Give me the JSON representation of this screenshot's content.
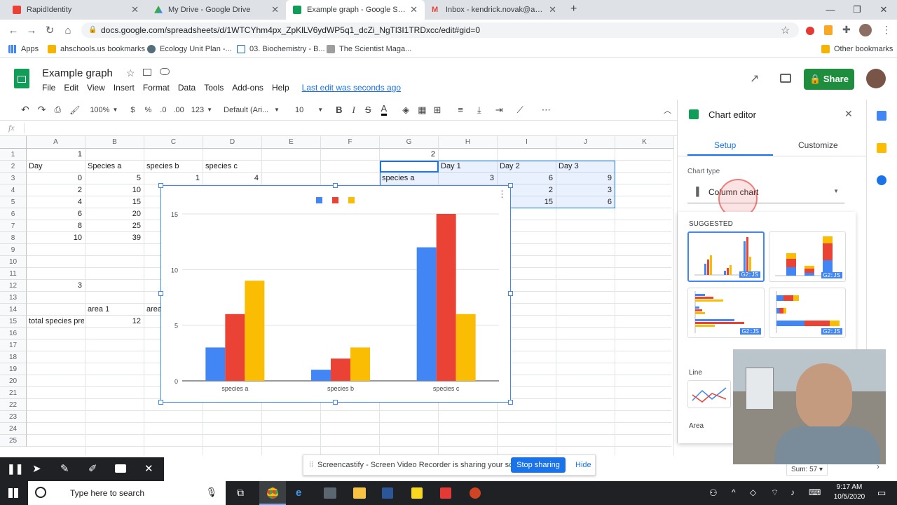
{
  "browser": {
    "tabs": [
      {
        "title": "RapidIdentity",
        "color": "#e94235"
      },
      {
        "title": "My Drive - Google Drive",
        "color": "#34a853"
      },
      {
        "title": "Example graph - Google Sheets",
        "color": "#0f9d58"
      },
      {
        "title": "Inbox - kendrick.novak@ahschoo",
        "color": "#ea4335"
      }
    ],
    "url": "docs.google.com/spreadsheets/d/1WTCYhm4px_ZpKlLV6ydWP5q1_dcZi_NgTl3I1TRDxcc/edit#gid=0",
    "bookmarks": [
      "Apps",
      "ahschools.us bookmarks",
      "Ecology Unit Plan -...",
      "03. Biochemistry - B...",
      "The Scientist Maga...",
      "Other bookmarks"
    ]
  },
  "doc": {
    "title": "Example graph",
    "menus": [
      "File",
      "Edit",
      "View",
      "Insert",
      "Format",
      "Data",
      "Tools",
      "Add-ons",
      "Help"
    ],
    "last_edit": "Last edit was seconds ago",
    "share": "Share"
  },
  "toolbar": {
    "zoom": "100%",
    "currency": "$",
    "percent": "%",
    "dec1": ".0",
    "dec2": ".00",
    "numfmt": "123",
    "font": "Default (Ari...",
    "size": "10",
    "bold": "B",
    "italic": "I",
    "strike": "S",
    "color": "A"
  },
  "fx": "fx",
  "columns": [
    "A",
    "B",
    "C",
    "D",
    "E",
    "F",
    "G",
    "H",
    "I",
    "J",
    "K"
  ],
  "rows": [
    "1",
    "2",
    "3",
    "4",
    "5",
    "6",
    "7",
    "8",
    "9",
    "10",
    "11",
    "12",
    "13",
    "14",
    "15",
    "16",
    "17",
    "18",
    "19",
    "20",
    "21",
    "22",
    "23",
    "24",
    "25"
  ],
  "cells": {
    "a1": "1",
    "g1": "2",
    "a2": "Day",
    "b2": "Species a",
    "c2": "species b",
    "d2": "species c",
    "h2": "Day 1",
    "i2": "Day 2",
    "j2": "Day 3",
    "a3": "0",
    "b3": "5",
    "c3": "1",
    "d3": "4",
    "g3": "species a",
    "h3": "3",
    "i3": "6",
    "j3": "9",
    "a4": "2",
    "b4": "10",
    "i4": "2",
    "j4": "3",
    "a5": "4",
    "b5": "15",
    "i5": "15",
    "j5": "6",
    "a6": "6",
    "b6": "20",
    "a7": "8",
    "b7": "25",
    "a8": "10",
    "b8": "39",
    "a12": "3",
    "b14": "area 1",
    "c14": "area",
    "a15": "total species pre",
    "b15": "12"
  },
  "chart_data": {
    "type": "bar",
    "categories": [
      "species a",
      "species b",
      "species c"
    ],
    "series": [
      {
        "values": [
          3,
          1,
          12
        ],
        "color": "#4285f4"
      },
      {
        "values": [
          6,
          2,
          15
        ],
        "color": "#ea4335"
      },
      {
        "values": [
          9,
          3,
          6
        ],
        "color": "#fbbc04"
      }
    ],
    "ylim": [
      0,
      15
    ],
    "yticks": [
      "0",
      "5",
      "10",
      "15"
    ],
    "grid": true
  },
  "editor": {
    "title": "Chart editor",
    "tab_setup": "Setup",
    "tab_customize": "Customize",
    "chart_type_label": "Chart type",
    "chart_type_value": "Column chart",
    "suggested": "SUGGESTED",
    "badge": "G2::JS",
    "line": "Line",
    "area": "Area"
  },
  "screencast": {
    "message": "Screencastify - Screen Video Recorder is sharing your screen.",
    "stop": "Stop sharing",
    "hide": "Hide"
  },
  "status": {
    "sum": "Sum: 57"
  },
  "taskbar": {
    "search": "Type here to search",
    "time": "9:17 AM",
    "date": "10/5/2020"
  }
}
